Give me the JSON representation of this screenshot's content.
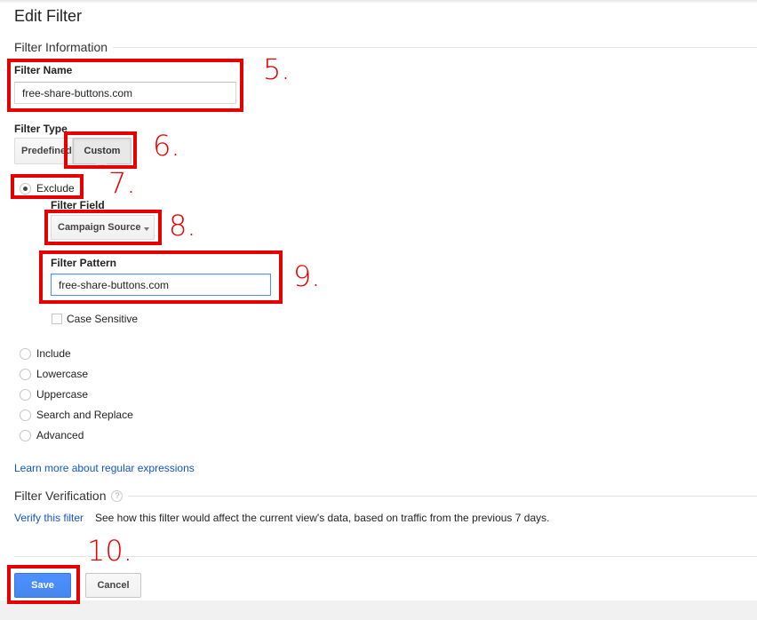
{
  "page": {
    "title": "Edit Filter"
  },
  "filter_information": {
    "section_title": "Filter Information",
    "filter_name_label": "Filter Name",
    "filter_name_value": "free-share-buttons.com",
    "filter_type_label": "Filter Type",
    "filter_type_options": [
      "Predefined",
      "Custom"
    ],
    "filter_type_selected": "Custom"
  },
  "custom_options": [
    {
      "label": "Exclude",
      "checked": true
    },
    {
      "label": "Include",
      "checked": false
    },
    {
      "label": "Lowercase",
      "checked": false
    },
    {
      "label": "Uppercase",
      "checked": false
    },
    {
      "label": "Search and Replace",
      "checked": false
    },
    {
      "label": "Advanced",
      "checked": false
    }
  ],
  "exclude": {
    "filter_field_label": "Filter Field",
    "filter_field_value": "Campaign Source",
    "filter_pattern_label": "Filter Pattern",
    "filter_pattern_value": "free-share-buttons.com",
    "case_sensitive_label": "Case Sensitive"
  },
  "learn_more_link": "Learn more about regular expressions",
  "verification": {
    "section_title": "Filter Verification",
    "help_icon_text": "?",
    "link": "Verify this filter",
    "description": "See how this filter would affect the current view's data, based on traffic from the previous 7 days."
  },
  "actions": {
    "save": "Save",
    "cancel": "Cancel"
  },
  "annotations": {
    "color": "#e60000",
    "steps": [
      "5.",
      "6.",
      "7.",
      "8.",
      "9.",
      "10."
    ]
  },
  "colors": {
    "primary_button": "#4d90fe",
    "link": "#1155cc"
  }
}
